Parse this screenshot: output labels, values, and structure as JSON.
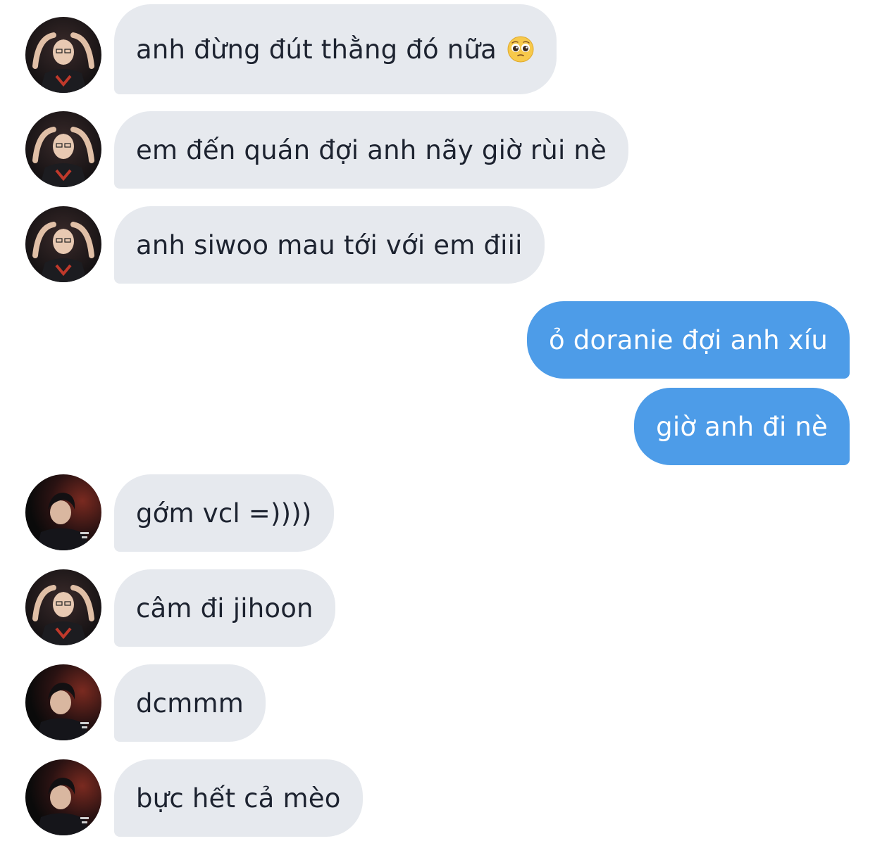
{
  "conversation": {
    "messages": [
      {
        "sender": "anh-a",
        "direction": "incoming",
        "text": "anh đừng đút thằng đó nữa",
        "emoji": "pleading-face-icon"
      },
      {
        "sender": "anh-a",
        "direction": "incoming",
        "text": "em đến quán đợi anh nãy giờ rùi nè"
      },
      {
        "sender": "anh-a",
        "direction": "incoming",
        "text": "anh siwoo mau tới với em điii"
      },
      {
        "sender": "me",
        "direction": "outgoing",
        "text": "ỏ doranie đợi anh xíu"
      },
      {
        "sender": "me",
        "direction": "outgoing",
        "text": "giờ anh đi nè"
      },
      {
        "sender": "anh-b",
        "direction": "incoming",
        "text": "gớm vcl =))))"
      },
      {
        "sender": "anh-a",
        "direction": "incoming",
        "text": "câm đi jihoon"
      },
      {
        "sender": "anh-b",
        "direction": "incoming",
        "text": "dcmmm"
      },
      {
        "sender": "anh-b",
        "direction": "incoming",
        "text": "bực hết cả mèo"
      }
    ]
  },
  "colors": {
    "incoming_bubble": "#e6e9ee",
    "incoming_text": "#1d2330",
    "outgoing_bubble": "#4d9ce8",
    "outgoing_text": "#ffffff",
    "background": "#ffffff"
  }
}
